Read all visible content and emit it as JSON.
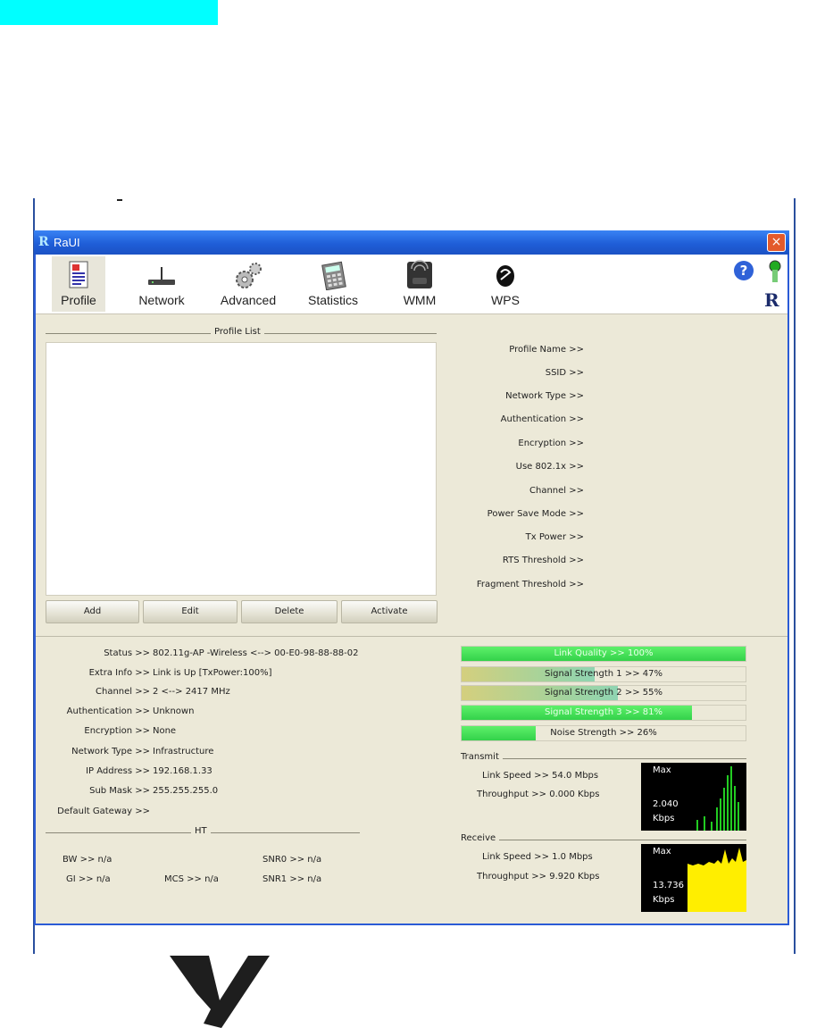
{
  "window": {
    "title": "RaUI",
    "close_glyph": "×"
  },
  "toolbar": {
    "items": [
      {
        "label": "Profile",
        "icon": "profile-icon"
      },
      {
        "label": "Network",
        "icon": "network-icon"
      },
      {
        "label": "Advanced",
        "icon": "advanced-icon"
      },
      {
        "label": "Statistics",
        "icon": "statistics-icon"
      },
      {
        "label": "WMM",
        "icon": "wmm-icon"
      },
      {
        "label": "WPS",
        "icon": "wps-icon"
      }
    ],
    "help_glyph": "?"
  },
  "profile_list": {
    "legend": "Profile List",
    "buttons": {
      "add": "Add",
      "edit": "Edit",
      "delete": "Delete",
      "activate": "Activate"
    }
  },
  "profile_details": [
    "Profile Name >>",
    "SSID >>",
    "Network Type >>",
    "Authentication >>",
    "Encryption >>",
    "Use 802.1x >>",
    "Channel >>",
    "Power Save Mode >>",
    "Tx Power >>",
    "RTS Threshold >>",
    "Fragment Threshold >>"
  ],
  "status": [
    {
      "label": "Status >>",
      "value": "802.11g-AP -Wireless  <--> 00-E0-98-88-88-02"
    },
    {
      "label": "Extra Info >>",
      "value": "Link is Up [TxPower:100%]"
    },
    {
      "label": "Channel >>",
      "value": "2 <--> 2417 MHz"
    },
    {
      "label": "Authentication >>",
      "value": "Unknown"
    },
    {
      "label": "Encryption >>",
      "value": "None"
    },
    {
      "label": "Network Type >>",
      "value": "Infrastructure"
    },
    {
      "label": "IP Address >>",
      "value": "192.168.1.33"
    },
    {
      "label": "Sub Mask >>",
      "value": "255.255.255.0"
    },
    {
      "label": "Default Gateway >>",
      "value": ""
    }
  ],
  "ht": {
    "legend": "HT",
    "bw": "BW >> n/a",
    "gi": "GI >> n/a",
    "mcs": "MCS >> n/a",
    "snr0": "SNR0 >> n/a",
    "snr1": "SNR1 >> n/a"
  },
  "meters": [
    {
      "label": "Link Quality >> 100%",
      "level": 1.0,
      "color": "#33d24a"
    },
    {
      "label": "Signal Strength 1 >> 47%",
      "level": 0.47,
      "color": "#cbc97a"
    },
    {
      "label": "Signal Strength 2 >> 55%",
      "level": 0.55,
      "color": "#cbc97a"
    },
    {
      "label": "Signal Strength 3 >> 81%",
      "level": 0.81,
      "color": "#33d24a"
    },
    {
      "label": "Noise Strength >> 26%",
      "level": 0.26,
      "color": "#33d24a"
    }
  ],
  "transmit": {
    "legend": "Transmit",
    "link_speed": "Link Speed >> 54.0 Mbps",
    "throughput": "Throughput >> 0.000 Kbps",
    "graph": {
      "max_label": "Max",
      "value": "2.040",
      "unit": "Kbps",
      "color": "#22cc22"
    }
  },
  "receive": {
    "legend": "Receive",
    "link_speed": "Link Speed >> 1.0 Mbps",
    "throughput": "Throughput >> 9.920 Kbps",
    "graph": {
      "max_label": "Max",
      "value": "13.736",
      "unit": "Kbps",
      "color": "#ffee00"
    }
  }
}
